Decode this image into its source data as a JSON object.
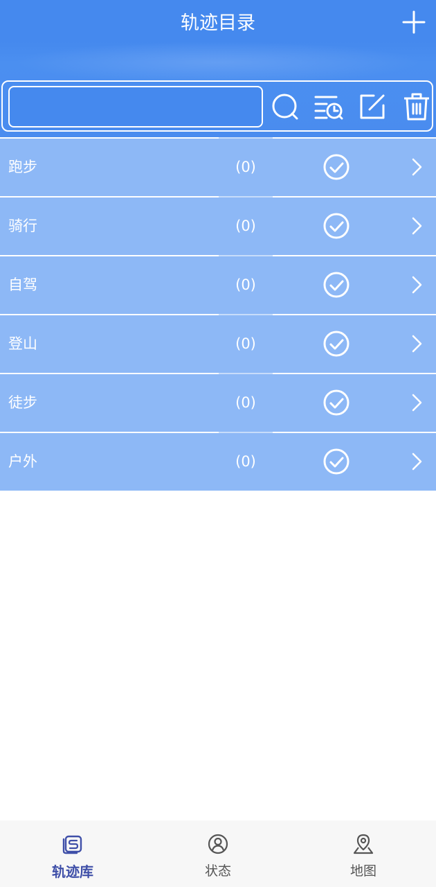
{
  "header": {
    "title": "轨迹目录",
    "add_icon": "plus-icon"
  },
  "toolbar": {
    "search_value": "",
    "icons": [
      "search-icon",
      "list-history-icon",
      "edit-icon",
      "trash-icon"
    ]
  },
  "list": {
    "items": [
      {
        "label": "跑步",
        "count": "(0)"
      },
      {
        "label": "骑行",
        "count": "(0)"
      },
      {
        "label": "自驾",
        "count": "(0)"
      },
      {
        "label": "登山",
        "count": "(0)"
      },
      {
        "label": "徒步",
        "count": "(0)"
      },
      {
        "label": "户外",
        "count": "(0)"
      }
    ]
  },
  "tabs": [
    {
      "label": "轨迹库",
      "icon": "track-library-icon",
      "active": true
    },
    {
      "label": "状态",
      "icon": "person-icon",
      "active": false
    },
    {
      "label": "地图",
      "icon": "map-pin-icon",
      "active": false
    }
  ],
  "colors": {
    "header_blue": "#4589ee",
    "row_blue": "#8db8f6",
    "active_tab": "#3f4fa8"
  }
}
